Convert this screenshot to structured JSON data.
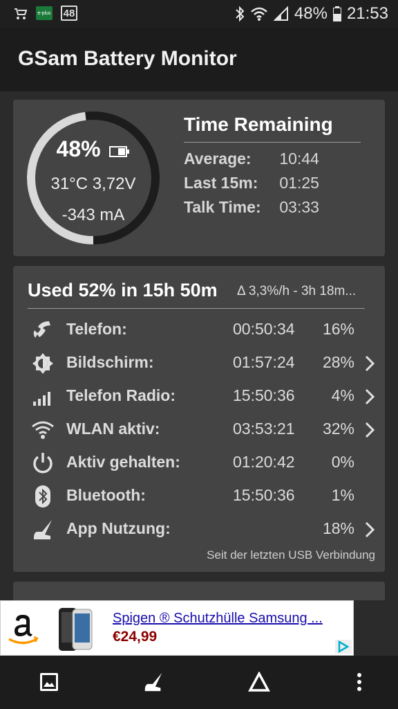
{
  "status_bar": {
    "left_icons": [
      "stroller-icon",
      "eplus-icon",
      "sim-48-icon"
    ],
    "eplus_label": "e-plus",
    "sim_label": "48",
    "right_icons": [
      "bluetooth-icon",
      "wifi-icon",
      "signal-icon"
    ],
    "battery_text": "48%",
    "time": "21:53"
  },
  "app_bar": {
    "title": "GSam Battery Monitor"
  },
  "battery_card": {
    "percent_text": "48%",
    "level_fraction": 0.48,
    "temp_voltage": "31°C  3,72V",
    "current": "-343 mA",
    "time_remaining": {
      "title": "Time Remaining",
      "rows": [
        {
          "label": "Average:",
          "value": "10:44"
        },
        {
          "label": "Last 15m:",
          "value": "01:25"
        },
        {
          "label": "Talk Time:",
          "value": "03:33"
        }
      ]
    }
  },
  "usage_card": {
    "title": "Used 52% in 15h 50m",
    "rate": "Δ 3,3%/h - 3h 18m...",
    "rows": [
      {
        "icon": "phone-icon",
        "label": "Telefon:",
        "time": "00:50:34",
        "pct": "16%",
        "chevron": false
      },
      {
        "icon": "brightness-icon",
        "label": "Bildschirm:",
        "time": "01:57:24",
        "pct": "28%",
        "chevron": true
      },
      {
        "icon": "signal-bars-icon",
        "label": "Telefon Radio:",
        "time": "15:50:36",
        "pct": "4%",
        "chevron": true
      },
      {
        "icon": "wifi-icon",
        "label": "WLAN aktiv:",
        "time": "03:53:21",
        "pct": "32%",
        "chevron": true
      },
      {
        "icon": "power-icon",
        "label": "Aktiv gehalten:",
        "time": "01:20:42",
        "pct": "0%",
        "chevron": false
      },
      {
        "icon": "bluetooth-icon",
        "label": "Bluetooth:",
        "time": "15:50:36",
        "pct": "1%",
        "chevron": false
      },
      {
        "icon": "app-usage-icon",
        "label": "App Nutzung:",
        "time": "",
        "pct": "18%",
        "chevron": true
      }
    ],
    "footer": "Seit der letzten USB Verbindung"
  },
  "ad": {
    "title": "Spigen ® Schutzhülle Samsung ...",
    "price": "€24,99"
  },
  "bottom_bar": {
    "items": [
      "image-icon",
      "app-usage-icon",
      "delta-icon",
      "more-vert-icon"
    ]
  },
  "colors": {
    "background": "#2b2b2b",
    "card": "#444444",
    "bar": "#1c1c1c",
    "gauge_track": "#1c1c1c",
    "gauge_fill": "#d9d9d9",
    "ad_link": "#1a0dab",
    "ad_price": "#8b0000"
  }
}
